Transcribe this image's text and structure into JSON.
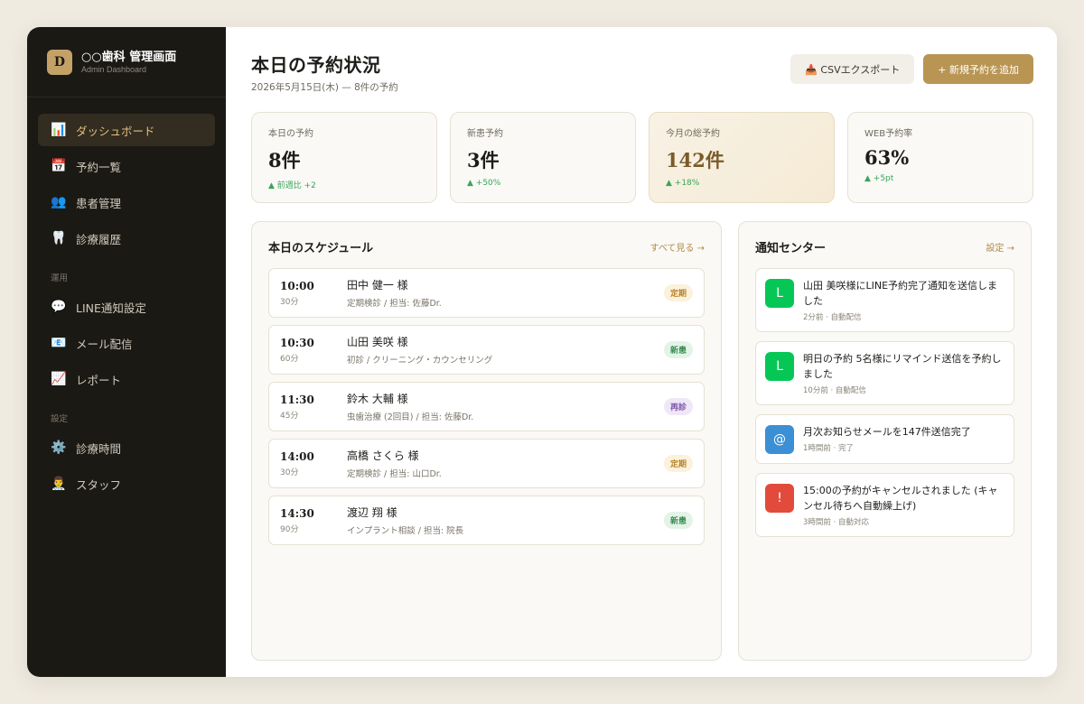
{
  "brand": {
    "logo": "D",
    "title": "○○歯科 管理画面",
    "subtitle": "Admin Dashboard"
  },
  "nav": {
    "items": [
      {
        "icon": "📊",
        "label": "ダッシュボード",
        "active": true
      },
      {
        "icon": "📅",
        "label": "予約一覧"
      },
      {
        "icon": "👥",
        "label": "患者管理"
      },
      {
        "icon": "🦷",
        "label": "診療履歴"
      }
    ],
    "section_ops": "運用",
    "ops_items": [
      {
        "icon": "💬",
        "label": "LINE通知設定"
      },
      {
        "icon": "📧",
        "label": "メール配信"
      },
      {
        "icon": "📈",
        "label": "レポート"
      }
    ],
    "section_settings": "設定",
    "settings_items": [
      {
        "icon": "⚙️",
        "label": "診療時間"
      },
      {
        "icon": "👨‍⚕️",
        "label": "スタッフ"
      }
    ]
  },
  "header": {
    "title": "本日の予約状況",
    "subtitle": "2026年5月15日(木) — 8件の予約",
    "export_label": "📥 CSVエクスポート",
    "add_label": "+ 新規予約を追加"
  },
  "stats": [
    {
      "label": "本日の予約",
      "value": "8件",
      "trend": "▲ 前週比 +2"
    },
    {
      "label": "新患予約",
      "value": "3件",
      "trend": "▲ +50%"
    },
    {
      "label": "今月の総予約",
      "value": "142件",
      "trend": "▲ +18%"
    },
    {
      "label": "WEB予約率",
      "value": "63%",
      "trend": "▲ +5pt"
    }
  ],
  "schedule": {
    "title": "本日のスケジュール",
    "link": "すべて見る →",
    "items": [
      {
        "time": "10:00",
        "duration": "30分",
        "name": "田中 健一 様",
        "detail": "定期検診 / 担当: 佐藤Dr.",
        "tag": "定期"
      },
      {
        "time": "10:30",
        "duration": "60分",
        "name": "山田 美咲 様",
        "detail": "初診 / クリーニング・カウンセリング",
        "tag": "新患"
      },
      {
        "time": "11:30",
        "duration": "45分",
        "name": "鈴木 大輔 様",
        "detail": "虫歯治療 (2回目) / 担当: 佐藤Dr.",
        "tag": "再診"
      },
      {
        "time": "14:00",
        "duration": "30分",
        "name": "高橋 さくら 様",
        "detail": "定期検診 / 担当: 山口Dr.",
        "tag": "定期"
      },
      {
        "time": "14:30",
        "duration": "90分",
        "name": "渡辺 翔 様",
        "detail": "インプラント相談 / 担当: 院長",
        "tag": "新患"
      }
    ]
  },
  "notifications": {
    "title": "通知センター",
    "link": "設定 →",
    "items": [
      {
        "icon": "L",
        "color": "#06c755",
        "text": "山田 美咲様にLINE予約完了通知を送信しました",
        "meta": "2分前 · 自動配信"
      },
      {
        "icon": "L",
        "color": "#06c755",
        "text": "明日の予約 5名様にリマインド送信を予約しました",
        "meta": "10分前 · 自動配信"
      },
      {
        "icon": "@",
        "color": "#3b8fd4",
        "text": "月次お知らせメールを147件送信完了",
        "meta": "1時間前 · 完了"
      },
      {
        "icon": "!",
        "color": "#e24b3b",
        "text": "15:00の予約がキャンセルされました (キャンセル待ちへ自動繰上げ)",
        "meta": "3時間前 · 自動対応"
      }
    ]
  }
}
